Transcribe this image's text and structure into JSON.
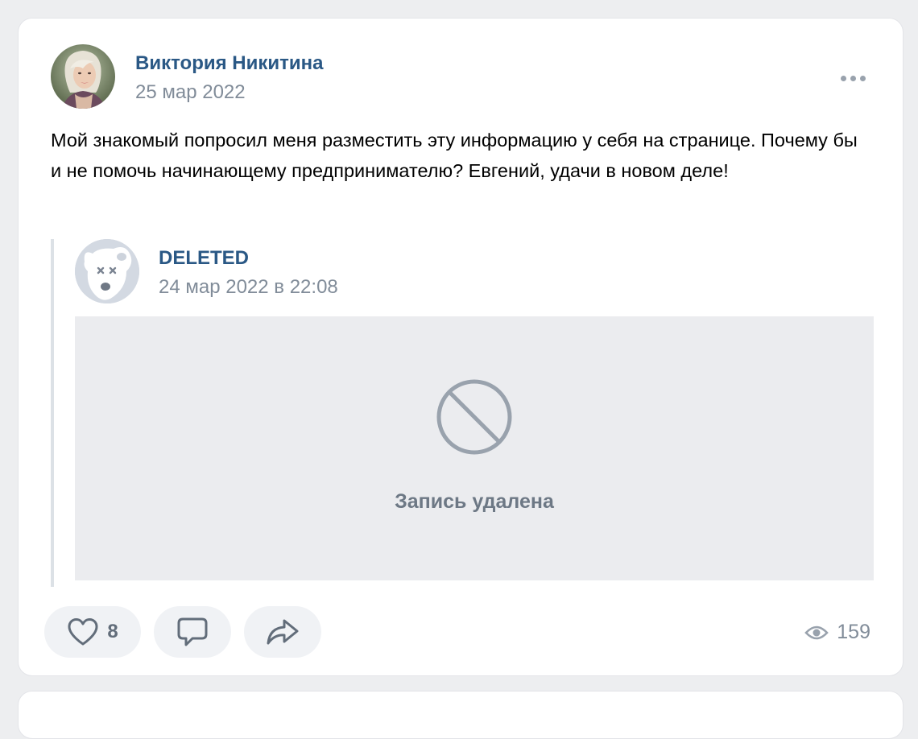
{
  "post": {
    "author": "Виктория Никитина",
    "date": "25 мар 2022",
    "text": "Мой знакомый попросил меня разместить эту информацию у себя на странице. Почему бы и не помочь начинающему предпринимателю? Евгений, удачи в новом деле!",
    "avatar_icon": "user-photo-avatar"
  },
  "repost": {
    "author": "DELETED",
    "date": "24 мар 2022 в 22:08",
    "avatar_icon": "deleted-dog-avatar",
    "deleted_icon": "blocked-circle-icon",
    "deleted_message": "Запись удалена"
  },
  "actions": {
    "like_count": "8",
    "like_icon": "heart-icon",
    "comment_icon": "comment-icon",
    "share_icon": "share-arrow-icon"
  },
  "views": {
    "count": "159",
    "icon": "eye-icon"
  },
  "colors": {
    "link": "#2a5885",
    "secondary_text": "#818c99",
    "card_background": "#ffffff",
    "page_background": "#edeef0",
    "deleted_box": "#ebecef",
    "icon_gray": "#99a2ad"
  }
}
